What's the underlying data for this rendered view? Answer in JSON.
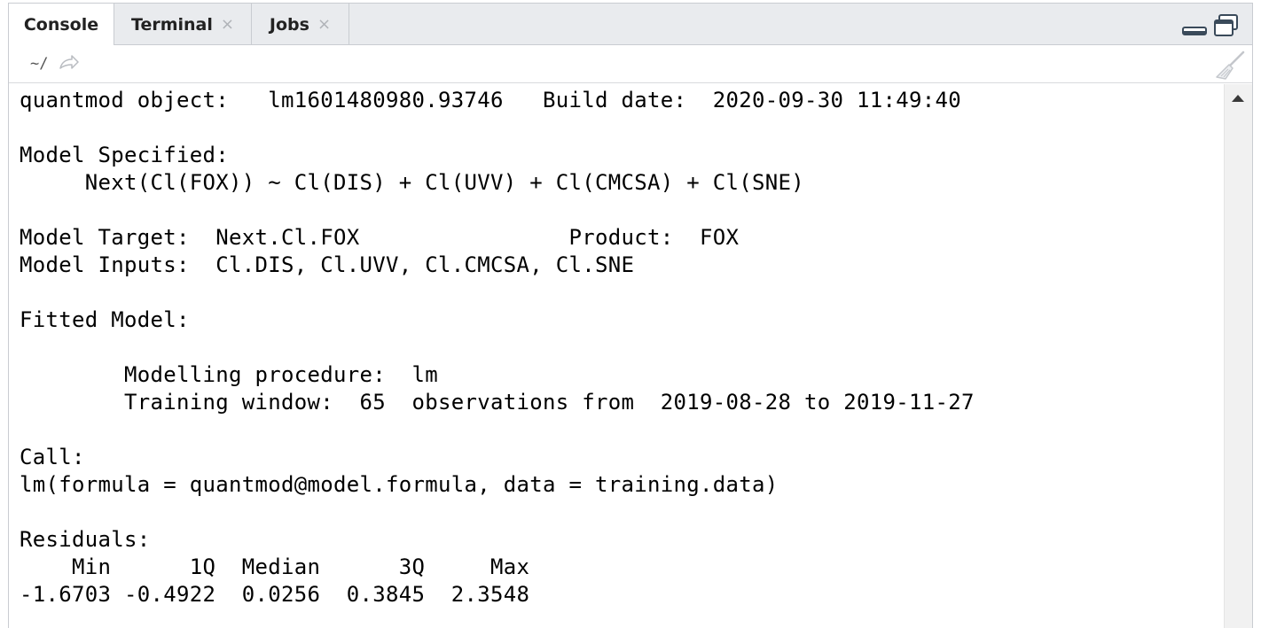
{
  "tabs": [
    {
      "label": "Console",
      "active": true,
      "closable": false
    },
    {
      "label": "Terminal",
      "active": false,
      "closable": true
    },
    {
      "label": "Jobs",
      "active": false,
      "closable": true
    }
  ],
  "close_glyph": "×",
  "pathbar": {
    "path": "~/",
    "go_icon": "arrow-right-icon",
    "clear_icon": "broom-icon"
  },
  "window_controls": {
    "minimize_icon": "minimize-icon",
    "maximize_icon": "maximize-icon"
  },
  "console": {
    "lines": [
      "quantmod object:   lm1601480980.93746   Build date:  2020-09-30 11:49:40",
      "",
      "Model Specified:",
      "     Next(Cl(FOX)) ~ Cl(DIS) + Cl(UVV) + Cl(CMCSA) + Cl(SNE)",
      "",
      "Model Target:  Next.Cl.FOX                Product:  FOX",
      "Model Inputs:  Cl.DIS, Cl.UVV, Cl.CMCSA, Cl.SNE",
      "",
      "Fitted Model:",
      "",
      "        Modelling procedure:  lm",
      "        Training window:  65  observations from  2019-08-28 to 2019-11-27",
      "",
      "Call:",
      "lm(formula = quantmod@model.formula, data = training.data)",
      "",
      "Residuals:",
      "    Min      1Q  Median      3Q     Max",
      "-1.6703 -0.4922  0.0256  0.3845  2.3548"
    ]
  },
  "colors": {
    "tab_bg": "#e9ebee",
    "border": "#c9ccd1",
    "text": "#000000"
  }
}
